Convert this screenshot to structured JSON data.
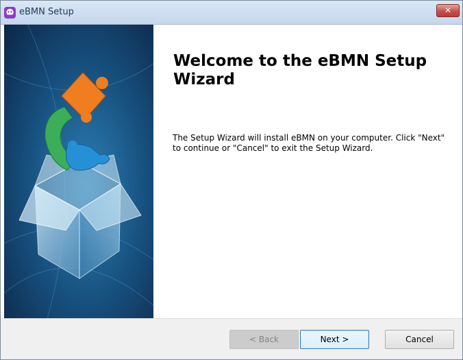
{
  "window": {
    "title": "eBMN Setup",
    "close_label": "✕",
    "app_icon": "ebmn-app-icon"
  },
  "wizard": {
    "heading": "Welcome to the eBMN Setup Wizard",
    "description": "The Setup Wizard will install eBMN on your computer.  Click \"Next\" to continue or \"Cancel\" to exit the Setup Wizard."
  },
  "buttons": {
    "back": "< Back",
    "next": "Next >",
    "cancel": "Cancel"
  },
  "colors": {
    "panel_dark": "#0c2a4a",
    "panel_mid": "#2a7bb0",
    "puzzle_orange": "#f07d1f",
    "puzzle_green": "#3cae5a",
    "puzzle_blue": "#2690d6"
  }
}
